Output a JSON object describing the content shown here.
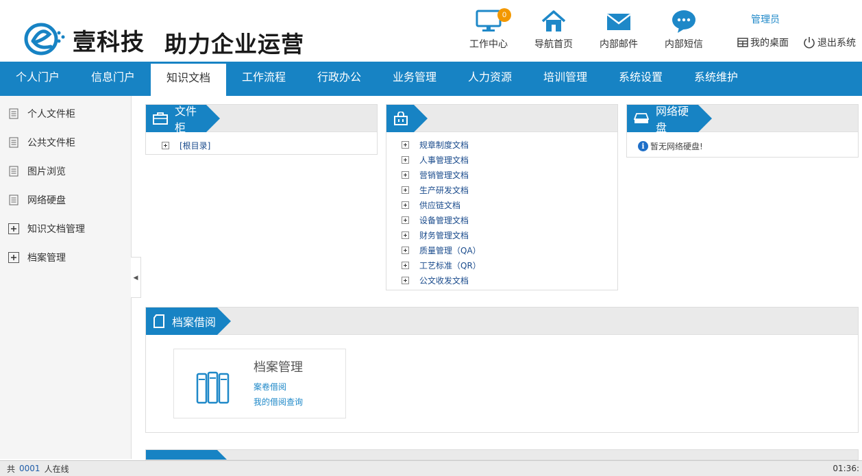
{
  "header": {
    "brand": "壹科技",
    "slogan": "助力企业运营",
    "icons": [
      {
        "label": "工作中心",
        "icon": "monitor-icon",
        "badge": "0"
      },
      {
        "label": "导航首页",
        "icon": "home-icon"
      },
      {
        "label": "内部邮件",
        "icon": "mail-icon"
      },
      {
        "label": "内部短信",
        "icon": "chat-icon"
      }
    ],
    "admin": "管理员",
    "desktop": "我的桌面",
    "logout": "退出系统"
  },
  "nav": {
    "items": [
      "个人门户",
      "信息门户",
      "知识文档",
      "工作流程",
      "行政办公",
      "业务管理",
      "人力资源",
      "培训管理",
      "系统设置",
      "系统维护"
    ],
    "active_index": 2
  },
  "sidebar": {
    "items": [
      {
        "label": "个人文件柜",
        "icon": "document-icon"
      },
      {
        "label": "公共文件柜",
        "icon": "document-icon"
      },
      {
        "label": "图片浏览",
        "icon": "document-icon"
      },
      {
        "label": "网络硬盘",
        "icon": "document-icon"
      },
      {
        "label": "知识文档管理",
        "icon": "expand-icon"
      },
      {
        "label": "档案管理",
        "icon": "expand-icon"
      }
    ]
  },
  "panels": {
    "cabinet": {
      "title": "文件柜",
      "items": [
        "[根目录]"
      ]
    },
    "public": {
      "title": "",
      "items": [
        "规章制度文档",
        "人事管理文档",
        "营销管理文档",
        "生产研发文档",
        "供应链文档",
        "设备管理文档",
        "财务管理文档",
        "质量管理（QA）",
        "工艺标准（QR）",
        "公文收发文档"
      ]
    },
    "disk": {
      "title": "网络硬盘",
      "message": "暂无网络硬盘!"
    },
    "archive": {
      "title": "档案借阅",
      "card_title": "档案管理",
      "links": [
        "案卷借阅",
        "我的借阅查询"
      ]
    }
  },
  "footer": {
    "prefix": "共",
    "count": "0001",
    "suffix": "人在线",
    "time": "01:36:"
  },
  "colors": {
    "primary": "#1783c4",
    "accent": "#1e88c8",
    "badge": "#f39800"
  }
}
